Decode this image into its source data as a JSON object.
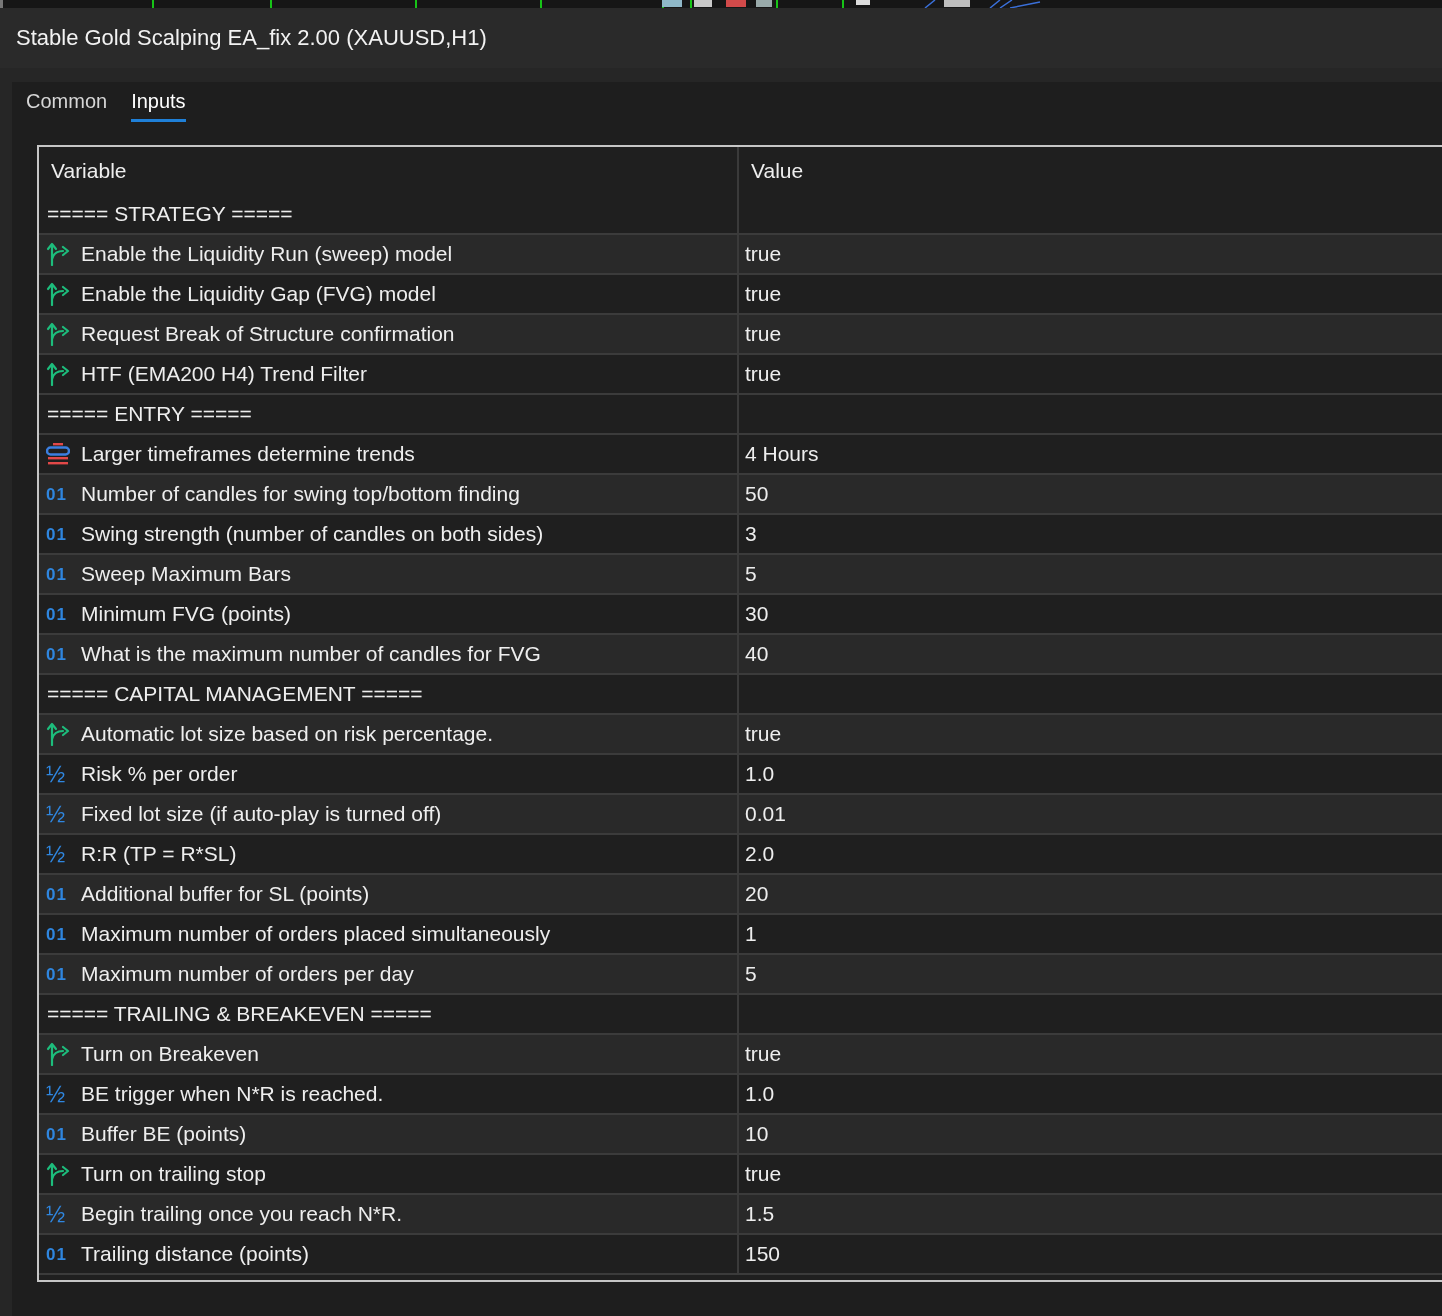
{
  "window": {
    "title": "Stable Gold Scalping EA_fix 2.00 (XAUUSD,H1)"
  },
  "tabs": [
    {
      "label": "Common",
      "selected": false
    },
    {
      "label": "Inputs",
      "selected": true
    }
  ],
  "table": {
    "columns": [
      "Variable",
      "Value"
    ],
    "rows": [
      {
        "kind": "section",
        "label": "===== STRATEGY ====="
      },
      {
        "kind": "bool",
        "label": "Enable the Liquidity Run (sweep) model",
        "value": "true"
      },
      {
        "kind": "bool",
        "label": "Enable the Liquidity Gap (FVG) model",
        "value": "true"
      },
      {
        "kind": "bool",
        "label": "Request Break of Structure confirmation",
        "value": "true"
      },
      {
        "kind": "bool",
        "label": "HTF (EMA200 H4) Trend Filter",
        "value": "true"
      },
      {
        "kind": "section",
        "label": "===== ENTRY ====="
      },
      {
        "kind": "enum",
        "label": "Larger timeframes determine trends",
        "value": "4 Hours"
      },
      {
        "kind": "int",
        "icon": "01",
        "label": "Number of candles for swing top/bottom finding",
        "value": "50"
      },
      {
        "kind": "int",
        "icon": "01",
        "label": "Swing strength (number of candles on both sides)",
        "value": "3"
      },
      {
        "kind": "int",
        "icon": "01",
        "label": "Sweep Maximum Bars",
        "value": "5"
      },
      {
        "kind": "int",
        "icon": "01",
        "label": "Minimum FVG (points)",
        "value": "30"
      },
      {
        "kind": "int",
        "icon": "01",
        "label": "What is the maximum number of candles for FVG",
        "value": "40"
      },
      {
        "kind": "section",
        "label": "===== CAPITAL MANAGEMENT ====="
      },
      {
        "kind": "bool",
        "label": "Automatic lot size based on risk percentage.",
        "value": "true"
      },
      {
        "kind": "double",
        "icon": "½",
        "label": "Risk % per order",
        "value": "1.0"
      },
      {
        "kind": "double",
        "icon": "½",
        "label": "Fixed lot size (if auto-play is turned off)",
        "value": "0.01"
      },
      {
        "kind": "double",
        "icon": "½",
        "label": "R:R (TP = R*SL)",
        "value": "2.0"
      },
      {
        "kind": "int",
        "icon": "01",
        "label": "Additional buffer for SL (points)",
        "value": "20"
      },
      {
        "kind": "int",
        "icon": "01",
        "label": "Maximum number of orders placed simultaneously",
        "value": "1"
      },
      {
        "kind": "int",
        "icon": "01",
        "label": "Maximum number of orders per day",
        "value": "5"
      },
      {
        "kind": "section",
        "label": "===== TRAILING & BREAKEVEN ====="
      },
      {
        "kind": "bool",
        "label": "Turn on Breakeven",
        "value": "true"
      },
      {
        "kind": "double",
        "icon": "½",
        "label": "BE trigger when N*R is reached.",
        "value": "1.0"
      },
      {
        "kind": "int",
        "icon": "01",
        "label": "Buffer BE (points)",
        "value": "10"
      },
      {
        "kind": "bool",
        "label": "Turn on trailing stop",
        "value": "true"
      },
      {
        "kind": "double",
        "icon": "½",
        "label": "Begin trailing once you reach N*R.",
        "value": "1.5"
      },
      {
        "kind": "int",
        "icon": "01",
        "label": "Trailing distance (points)",
        "value": "150"
      }
    ]
  }
}
